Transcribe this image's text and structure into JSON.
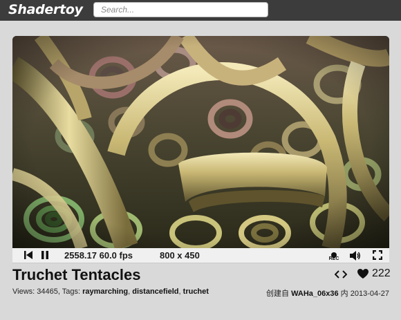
{
  "header": {
    "logo": "Shadertoy",
    "search_placeholder": "Search..."
  },
  "player": {
    "time_fps": "2558.17 60.0 fps",
    "resolution": "800 x 450",
    "rec_label": "REC"
  },
  "shader": {
    "title": "Truchet Tentacles",
    "likes": "222",
    "views_label": "Views: 34465, Tags:",
    "tags": [
      "raymarching",
      "distancefield",
      "truchet"
    ],
    "tag_separator": ", ",
    "created_prefix": "创建自",
    "author": "WAHa_06x36",
    "date_prefix": "内",
    "date": "2013-04-27"
  },
  "colors": {
    "topbar": "#3c3c3c",
    "page_bg": "#d9d9d9",
    "tube_gold": "#c9b874",
    "tube_green": "#7fae68",
    "tube_pink": "#b07a74"
  }
}
